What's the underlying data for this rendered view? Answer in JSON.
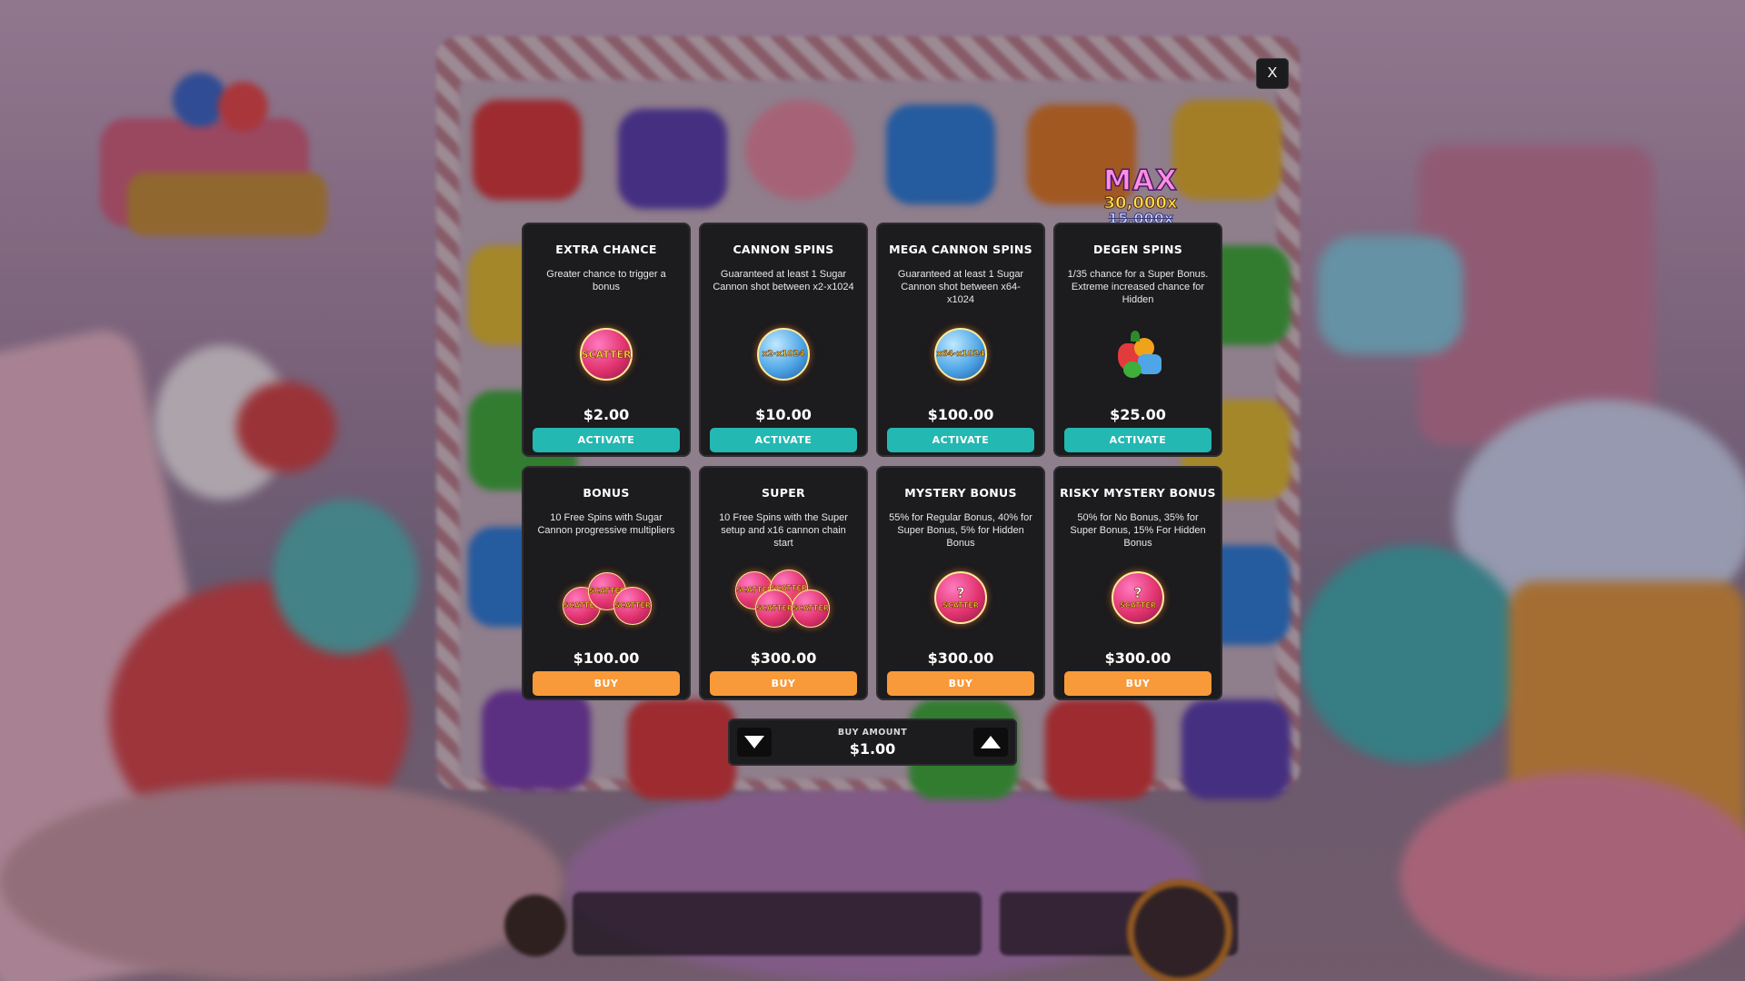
{
  "close_label": "X",
  "max_badge": {
    "max": "MAX",
    "multiplier": "30,000x",
    "old_multiplier": "15,000x"
  },
  "cards": [
    {
      "title": "EXTRA CHANCE",
      "description": "Greater chance to trigger a bonus",
      "price": "$2.00",
      "action": "ACTIVATE",
      "icon": "scatter-coin-icon",
      "icon_text": "SCATTER"
    },
    {
      "title": "CANNON SPINS",
      "description": "Guaranteed at least 1 Sugar Cannon shot between x2-x1024",
      "price": "$10.00",
      "action": "ACTIVATE",
      "icon": "x2-x1024-coin-icon",
      "icon_text": "x2-x1024"
    },
    {
      "title": "MEGA CANNON SPINS",
      "description": "Guaranteed at least 1 Sugar Cannon shot between x64-x1024",
      "price": "$100.00",
      "action": "ACTIVATE",
      "icon": "x64-x1024-coin-icon",
      "icon_text": "x64-x1024"
    },
    {
      "title": "DEGEN SPINS",
      "description": "1/35 chance for a Super Bonus. Extreme increased chance for Hidden",
      "price": "$25.00",
      "action": "ACTIVATE",
      "icon": "fruit-bunch-icon"
    },
    {
      "title": "BONUS",
      "description": "10 Free Spins with Sugar Cannon progressive multipliers",
      "price": "$100.00",
      "action": "BUY",
      "icon": "three-scatter-icon",
      "icon_text": "SCATTER"
    },
    {
      "title": "SUPER",
      "description": "10 Free Spins with the Super setup and x16 cannon chain start",
      "price": "$300.00",
      "action": "BUY",
      "icon": "four-scatter-icon",
      "icon_text": "SCATTER"
    },
    {
      "title": "MYSTERY BONUS",
      "description": "55% for Regular Bonus, 40% for Super Bonus, 5% for Hidden Bonus",
      "price": "$300.00",
      "action": "BUY",
      "icon": "mystery-scatter-icon",
      "icon_text": "SCATTER"
    },
    {
      "title": "RISKY MYSTERY BONUS",
      "description": "50% for No Bonus, 35% for Super Bonus, 15% For Hidden Bonus",
      "price": "$300.00",
      "action": "BUY",
      "icon": "mystery-scatter-icon",
      "icon_text": "SCATTER"
    }
  ],
  "buy_amount": {
    "label": "BUY AMOUNT",
    "value": "$1.00"
  },
  "colors": {
    "activate": "#23b8b2",
    "buy": "#f89a3a",
    "card_bg": "#1c1b1d"
  }
}
